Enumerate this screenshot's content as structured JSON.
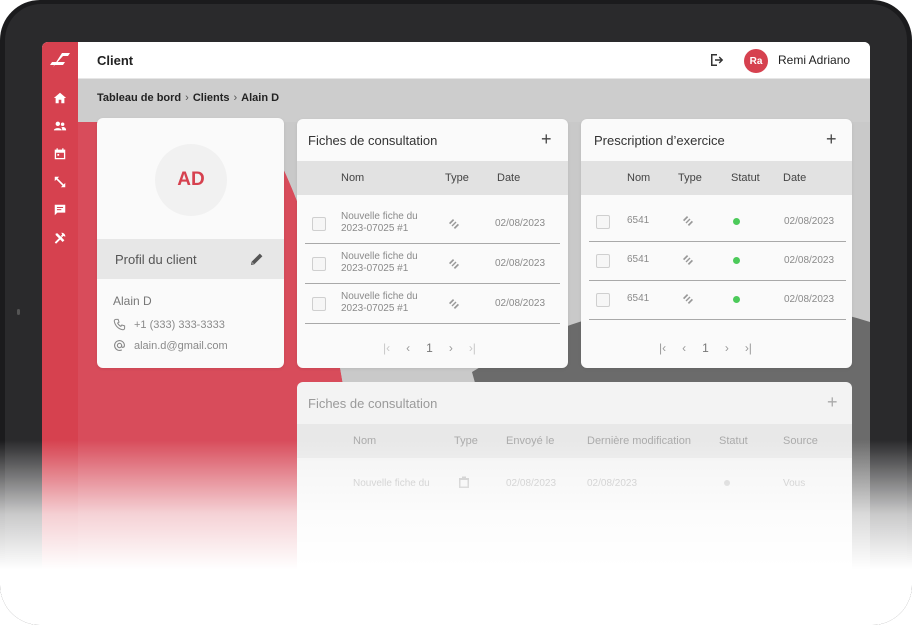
{
  "topbar": {
    "title": "Client",
    "username": "Remi Adriano",
    "user_initials": "Ra"
  },
  "breadcrumb": [
    "Tableau de bord",
    "Clients",
    "Alain D"
  ],
  "sidebar": {
    "items": [
      "home-icon",
      "users-icon",
      "calendar-icon",
      "expand-icon",
      "chat-icon",
      "tools-icon"
    ]
  },
  "profile": {
    "initials": "AD",
    "section_label": "Profil du client",
    "name": "Alain D",
    "phone": "+1 (333) 333-3333",
    "email": "alain.d@gmail.com"
  },
  "fiches": {
    "title": "Fiches de consultation",
    "columns": [
      "Nom",
      "Type",
      "Date"
    ],
    "rows": [
      {
        "name_line1": "Nouvelle fiche du",
        "name_line2": "2023-07025 #1",
        "date": "02/08/2023"
      },
      {
        "name_line1": "Nouvelle fiche du",
        "name_line2": "2023-07025 #1",
        "date": "02/08/2023"
      },
      {
        "name_line1": "Nouvelle fiche du",
        "name_line2": "2023-07025 #1",
        "date": "02/08/2023"
      }
    ],
    "page": "1"
  },
  "prescription": {
    "title": "Prescription d’exercice",
    "columns": [
      "Nom",
      "Type",
      "Statut",
      "Date"
    ],
    "rows": [
      {
        "name": "6541",
        "date": "02/08/2023",
        "status_color": "#4cca5a"
      },
      {
        "name": "6541",
        "date": "02/08/2023",
        "status_color": "#4cca5a"
      },
      {
        "name": "6541",
        "date": "02/08/2023",
        "status_color": "#4cca5a"
      }
    ],
    "page": "1"
  },
  "fiches_full": {
    "title": "Fiches de consultation",
    "columns": [
      "Nom",
      "Type",
      "Envoyé le",
      "Dernière modification",
      "Statut",
      "Source"
    ],
    "row": {
      "name": "Nouvelle fiche du",
      "sent": "02/08/2023",
      "modified": "02/08/2023",
      "source": "Vous"
    }
  },
  "colors": {
    "accent": "#d6414f",
    "status_ok": "#4cca5a"
  }
}
